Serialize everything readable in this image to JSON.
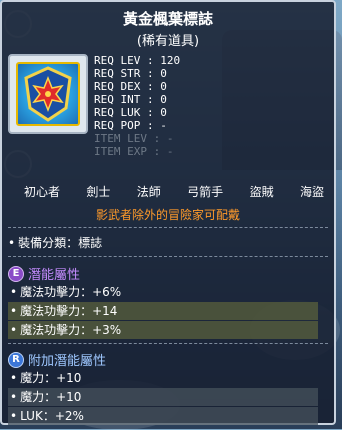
{
  "item": {
    "name": "黃金楓葉標誌",
    "rarity": "(稀有道具)",
    "icon": "golden-maple-leaf-emblem-icon"
  },
  "requirements": [
    {
      "label": "REQ LEV",
      "value": "120",
      "dim": false
    },
    {
      "label": "REQ STR",
      "value": "0",
      "dim": false
    },
    {
      "label": "REQ DEX",
      "value": "0",
      "dim": false
    },
    {
      "label": "REQ INT",
      "value": "0",
      "dim": false
    },
    {
      "label": "REQ LUK",
      "value": "0",
      "dim": false
    },
    {
      "label": "REQ POP",
      "value": "-",
      "dim": false
    },
    {
      "label": "ITEM LEV",
      "value": "-",
      "dim": true
    },
    {
      "label": "ITEM EXP",
      "value": "-",
      "dim": true
    }
  ],
  "jobs": [
    "初心者",
    "劍士",
    "法師",
    "弓箭手",
    "盜賊",
    "海盜"
  ],
  "job_warning": "影武者除外的冒險家可配戴",
  "equip_category": "裝備分類：標誌",
  "potential": {
    "title": "潛能屬性",
    "badge": "E",
    "lines": [
      "魔法功擊力：+6%",
      "魔法功擊力：+14",
      "魔法功擊力：+3%"
    ]
  },
  "bonus_potential": {
    "title": "附加潛能屬性",
    "badge": "R",
    "lines": [
      "魔力：+10",
      "魔力：+10",
      "LUK：+2%"
    ]
  },
  "colors": {
    "potential_title": "#c58cff",
    "bonus_title": "#9fc8ff",
    "warning": "#ff9a2a"
  }
}
